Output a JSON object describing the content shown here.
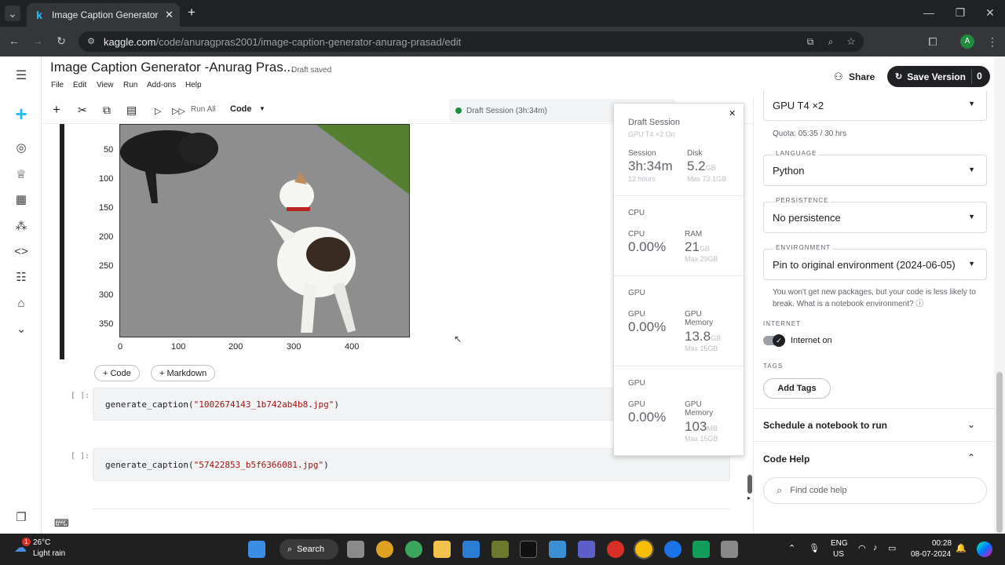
{
  "browser": {
    "tab_title": "Image Caption Generator -Anur",
    "tab_favicon": "k",
    "url_host": "kaggle.com",
    "url_path": "/code/anuragpras2001/image-caption-generator-anurag-prasad/edit",
    "profile_letter": "A"
  },
  "notebook": {
    "title": "Image Caption Generator -Anurag Pras...",
    "status": "Draft saved",
    "menu": [
      "File",
      "Edit",
      "View",
      "Run",
      "Add-ons",
      "Help"
    ],
    "share_label": "Share",
    "save_label": "Save Version",
    "save_count": "0",
    "run_all_label": "Run All",
    "cell_type": "Code",
    "session_pill": "Draft Session (3h:34m)"
  },
  "plot": {
    "y_ticks": [
      "50",
      "100",
      "150",
      "200",
      "250",
      "300",
      "350"
    ],
    "x_ticks": [
      "0",
      "100",
      "200",
      "300",
      "400"
    ]
  },
  "cells": {
    "add_code": "+ Code",
    "add_markdown": "+ Markdown",
    "prompt": "[ ]:",
    "cell1_fn": "generate_caption(",
    "cell1_arg": "\"1002674143_1b742ab4b8.jpg\"",
    "cell2_fn": "generate_caption(",
    "cell2_arg": "\"57422853_b5f6366081.jpg\"",
    "close_paren": ")"
  },
  "session": {
    "title": "Draft Session",
    "subtitle": "GPU T4 ×2 On",
    "session_label": "Session",
    "session_value": "3h:34m",
    "session_max": "12 hours",
    "disk_label": "Disk",
    "disk_value": "5.2",
    "disk_unit": "GB",
    "disk_max": "Max 73.1GB",
    "cpu_header": "CPU",
    "cpu_label": "CPU",
    "cpu_value": "0.00%",
    "ram_label": "RAM",
    "ram_value": "21",
    "ram_unit": "GB",
    "ram_max": "Max 29GB",
    "gpu1_header": "GPU",
    "gpu1_label": "GPU",
    "gpu1_value": "0.00%",
    "gpu1_mem_label": "GPU Memory",
    "gpu1_mem_value": "13.8",
    "gpu1_mem_unit": "GB",
    "gpu1_mem_max": "Max 15GB",
    "gpu2_header": "GPU",
    "gpu2_label": "GPU",
    "gpu2_value": "0.00%",
    "gpu2_mem_label": "GPU Memory",
    "gpu2_mem_value": "103",
    "gpu2_mem_unit": "MB",
    "gpu2_mem_max": "Max 15GB"
  },
  "settings": {
    "accelerator": "GPU T4 ×2",
    "quota": "Quota: 05:35 / 30 hrs",
    "language_label": "LANGUAGE",
    "language": "Python",
    "persistence_label": "PERSISTENCE",
    "persistence": "No persistence",
    "environment_label": "ENVIRONMENT",
    "environment": "Pin to original environment (2024-06-05)",
    "env_note": "You won't get new packages, but your code is less likely to break. What is a notebook environment?",
    "internet_label": "INTERNET",
    "internet_value": "Internet on",
    "tags_label": "TAGS",
    "add_tags": "Add Tags",
    "schedule": "Schedule a notebook to run",
    "code_help": "Code Help",
    "find_placeholder": "Find code help"
  },
  "taskbar": {
    "weather_temp": "26°C",
    "weather_desc": "Light rain",
    "weather_badge": "1",
    "search": "Search",
    "lang1": "ENG",
    "lang2": "US",
    "time": "00:28",
    "date": "08-07-2024"
  },
  "colors": {
    "accent_blue": "#20beff",
    "dark": "#202124",
    "green": "#1e8e3e"
  }
}
